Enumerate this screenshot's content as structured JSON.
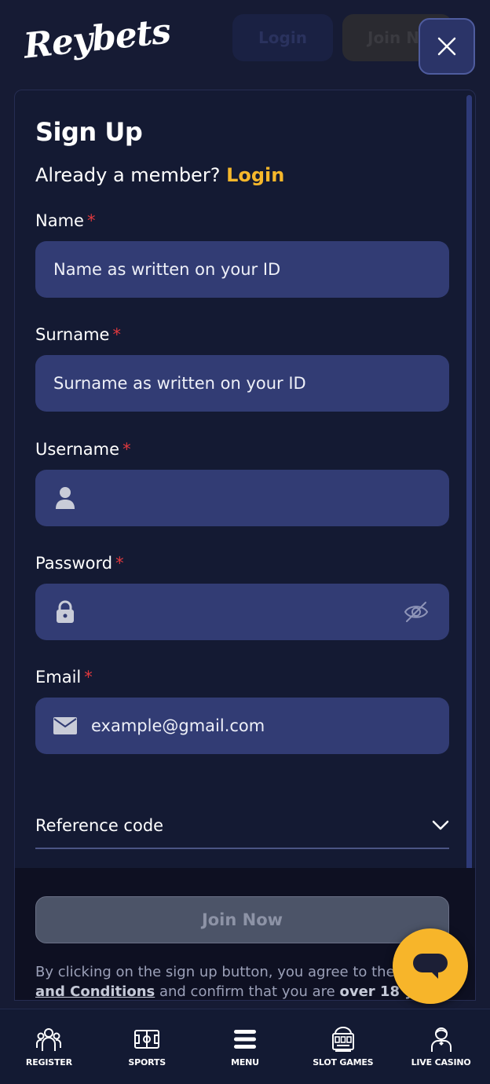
{
  "header": {
    "logo_text": "Reybets",
    "login_label": "Login",
    "join_label": "Join Now"
  },
  "modal": {
    "title": "Sign Up",
    "member_prompt": "Already a member?",
    "login_link": "Login",
    "fields": {
      "name": {
        "label": "Name",
        "required_mark": "*",
        "placeholder": "Name as written on your ID"
      },
      "surname": {
        "label": "Surname",
        "required_mark": "*",
        "placeholder": "Surname as written on your ID"
      },
      "username": {
        "label": "Username",
        "required_mark": "*",
        "placeholder": ""
      },
      "password": {
        "label": "Password",
        "required_mark": "*",
        "placeholder": ""
      },
      "email": {
        "label": "Email",
        "required_mark": "*",
        "placeholder": "example@gmail.com"
      }
    },
    "reference_code_label": "Reference code",
    "join_button": "Join Now",
    "terms": {
      "prefix": "By clicking on the sign up button, you agree to the",
      "terms_link": "and Conditions",
      "middle": "and confirm that you are",
      "age": "over 18 years"
    }
  },
  "bottom_nav": [
    {
      "label": "REGISTER",
      "icon": "register-icon"
    },
    {
      "label": "SPORTS",
      "icon": "sports-icon"
    },
    {
      "label": "MENU",
      "icon": "menu-icon"
    },
    {
      "label": "SLOT GAMES",
      "icon": "slot-machine-icon"
    },
    {
      "label": "LIVE CASINO",
      "icon": "dealer-icon"
    }
  ],
  "colors": {
    "accent": "#f5b72b",
    "required": "#e0393e",
    "field_bg": "#323c74",
    "page_bg": "#161b34"
  }
}
